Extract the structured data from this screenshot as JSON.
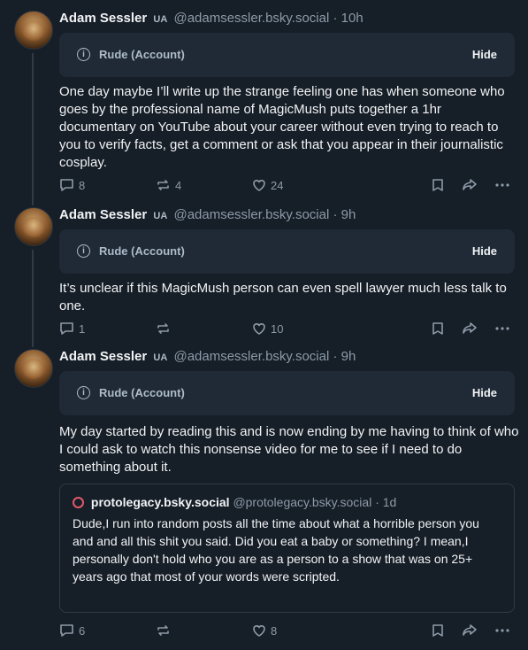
{
  "posts": [
    {
      "author_name": "Adam Sessler",
      "author_badge": "UA",
      "handle": "@adamsessler.bsky.social",
      "time": "10h",
      "warning_label": "Rude (Account)",
      "hide_label": "Hide",
      "text": "One day maybe I’ll write up the strange feeling one has when someone who goes by the professional name of MagicMush puts together a 1hr documentary on YouTube about your career without even trying to reach to you to verify facts, get a comment or ask that you appear in their journalistic cosplay.",
      "replies": "8",
      "reposts": "4",
      "likes": "24"
    },
    {
      "author_name": "Adam Sessler",
      "author_badge": "UA",
      "handle": "@adamsessler.bsky.social",
      "time": "9h",
      "warning_label": "Rude (Account)",
      "hide_label": "Hide",
      "text": "It’s unclear if this MagicMush person can even spell lawyer much less talk to one.",
      "replies": "1",
      "reposts": "",
      "likes": "10"
    },
    {
      "author_name": "Adam Sessler",
      "author_badge": "UA",
      "handle": "@adamsessler.bsky.social",
      "time": "9h",
      "warning_label": "Rude (Account)",
      "hide_label": "Hide",
      "text": "My day started by reading this and is now ending by me having to think of who I could ask to watch this nonsense video for me to see if I need to do something about it.",
      "replies": "6",
      "reposts": "",
      "likes": "8"
    }
  ],
  "quote": {
    "author_name": "protolegacy.bsky.social",
    "handle": "@protolegacy.bsky.social",
    "time": "1d",
    "text": "Dude,I run into random posts all the time about what a horrible person you and and all this shit you said. Did you eat a baby or something? I mean,I personally don't hold who you are as a person to a show that was on 25+ years ago that most of your words were scripted."
  },
  "separator": "·",
  "colors": {
    "background": "#161e27",
    "card": "#1f2a36",
    "muted": "#8d9aa8",
    "text": "#f1f3f5"
  }
}
